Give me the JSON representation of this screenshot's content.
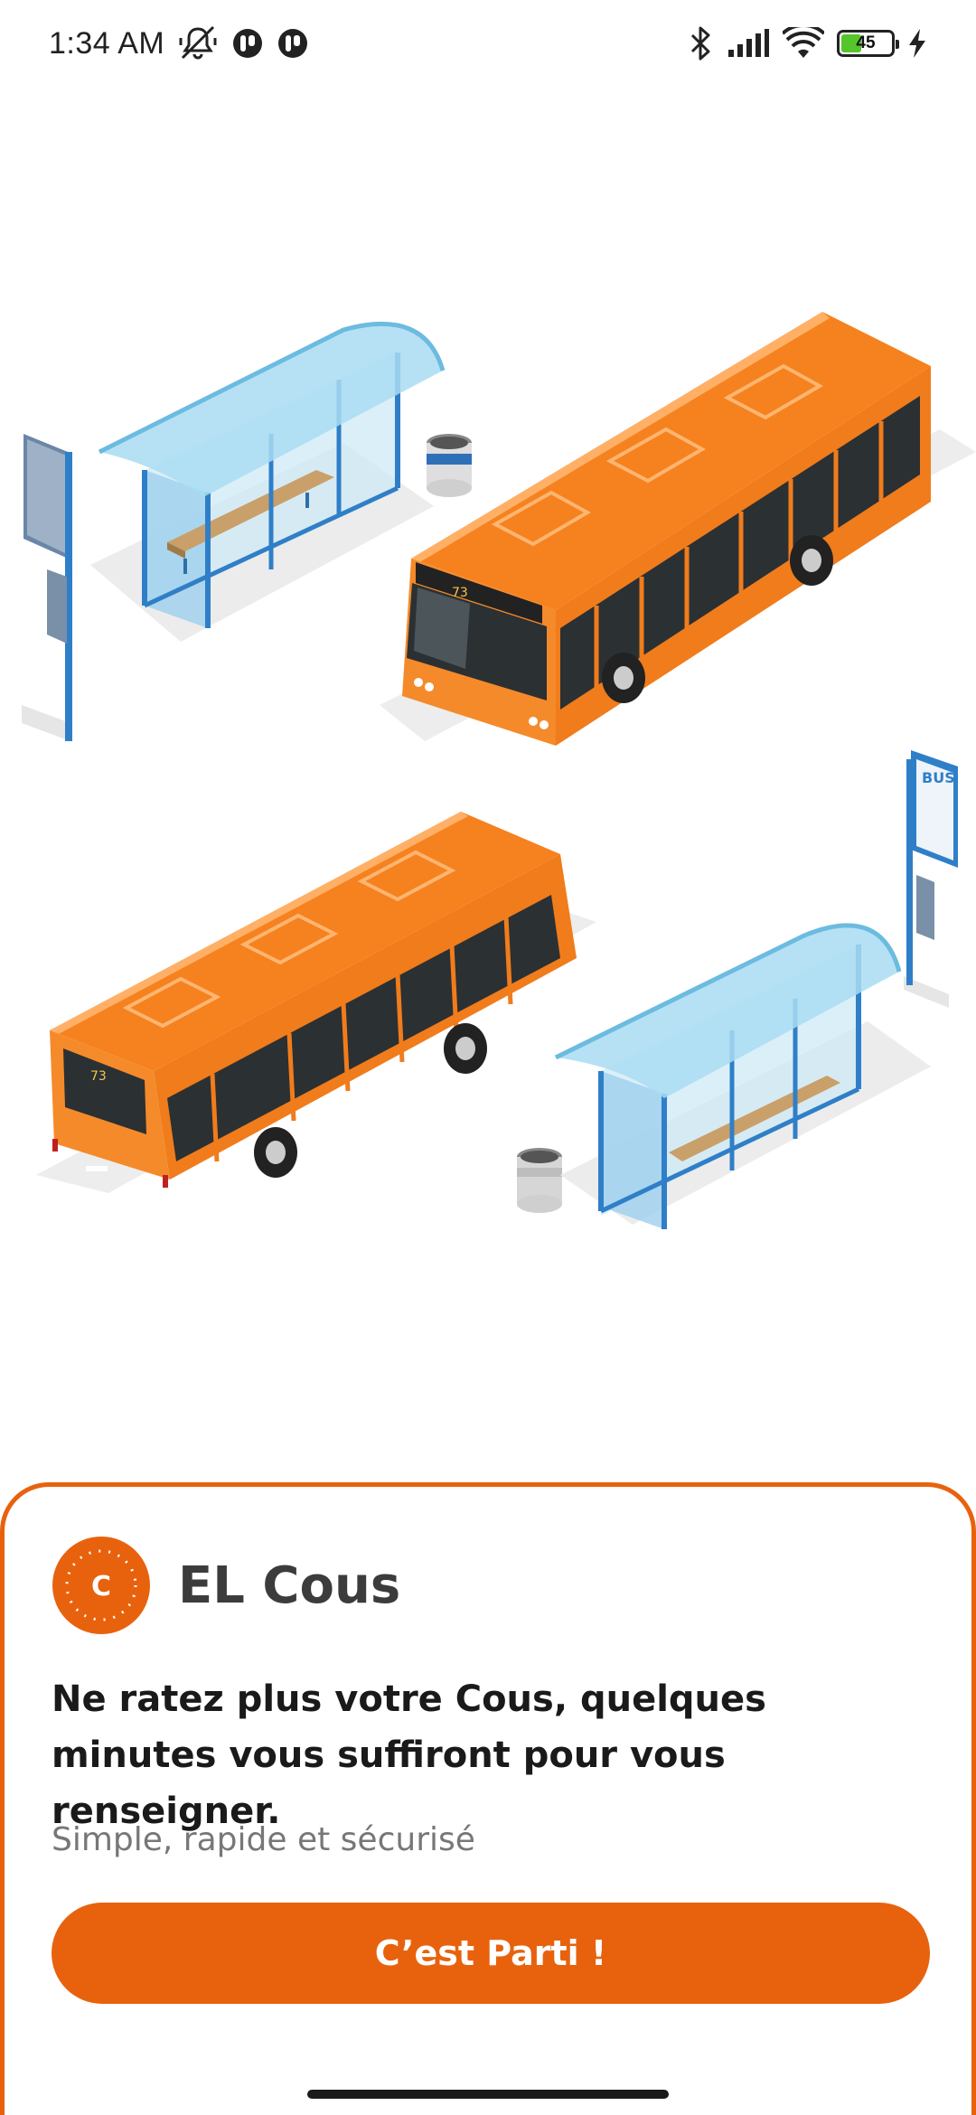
{
  "status_bar": {
    "time": "1:34 AM",
    "battery_level": "45",
    "battery_percent": 45,
    "icons": [
      "mute-icon",
      "notification-icon",
      "notification-icon",
      "bluetooth-icon",
      "signal-icon",
      "wifi-icon",
      "battery-icon",
      "charging-icon"
    ]
  },
  "illustration": {
    "bus_number_front": "73",
    "bus_number_rear": "73",
    "stop_sign_label": "BUS"
  },
  "card": {
    "logo_letter": "C",
    "app_name": "EL Cous",
    "headline": "Ne ratez plus votre Cous, quelques minutes vous suffiront pour vous renseigner.",
    "subtitle": "Simple, rapide et sécurisé",
    "cta_label": "C’est Parti !"
  },
  "colors": {
    "brand_orange": "#e8620e",
    "bus_orange": "#f5821f",
    "shelter_blue": "#7ecbe8",
    "text_dark": "#1a1a1a",
    "text_muted": "#777777"
  }
}
